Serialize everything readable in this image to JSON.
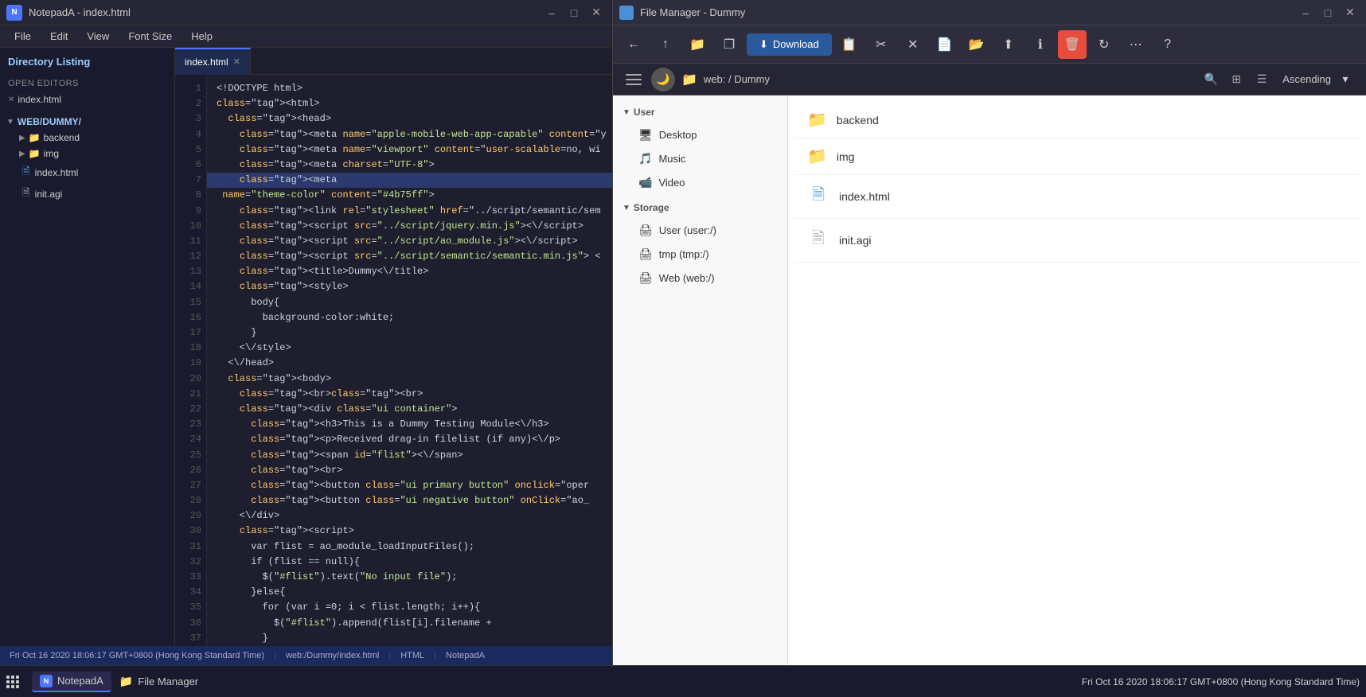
{
  "notepad": {
    "title": "NotepadA - index.html",
    "menubar": [
      "File",
      "Edit",
      "View",
      "Font Size",
      "Help"
    ],
    "tab": "index.html",
    "sidebar": {
      "directory_label": "Directory Listing",
      "open_editors_label": "OPEN EDITORS",
      "editors": [
        {
          "name": "index.html"
        }
      ],
      "folder_label": "WEB/DUMMY/",
      "folders": [
        {
          "name": "backend",
          "type": "folder"
        },
        {
          "name": "img",
          "type": "folder"
        },
        {
          "name": "index.html",
          "type": "file-html"
        },
        {
          "name": "init.agi",
          "type": "file"
        }
      ]
    },
    "lines": [
      "<!DOCTYPE html>",
      "<html>",
      "  <head>",
      "    <meta name=\"apple-mobile-web-app-capable\" content=\"y",
      "    <meta name=\"viewport\" content=\"user-scalable=no, wi",
      "    <meta charset=\"UTF-8\">",
      "    <meta name=\"theme-color\" content=\"#4b75ff\">",
      "    <link rel=\"stylesheet\" href=\"../script/semantic/sem",
      "    <script src=\"../script/jquery.min.js\"><\\/script>",
      "    <script src=\"../script/ao_module.js\"><\\/script>",
      "    <script src=\"../script/semantic/semantic.min.js\"> <",
      "    <title>Dummy<\\/title>",
      "    <style>",
      "      body{",
      "        background-color:white;",
      "      }",
      "    <\\/style>",
      "  <\\/head>",
      "  <body>",
      "    <br><br>",
      "    <div class=\"ui container\">",
      "      <h3>This is a Dummy Testing Module<\\/h3>",
      "      <p>Received drag-in filelist (if any)<\\/p>",
      "      <span id=\"flist\"><\\/span>",
      "      <br>",
      "      <button class=\"ui primary button\" onclick=\"oper",
      "      <button class=\"ui negative button\" onClick=\"ao_",
      "    <\\/div>",
      "    <script>",
      "      var flist = ao_module_loadInputFiles();",
      "      if (flist == null){",
      "        $(\"#flist\").text(\"No input file\");",
      "      }else{",
      "        for (var i =0; i < flist.length; i++){",
      "          $(\"#flist\").append(flist[i].filename +",
      "        }",
      "      }",
      "    }"
    ],
    "highlight_line": 7,
    "statusbar": {
      "datetime": "Fri Oct 16 2020 18:06:17 GMT+0800 (Hong Kong Standard Time)",
      "path": "web:/Dummy/index.html",
      "lang": "HTML",
      "app": "NotepadA"
    }
  },
  "filemanager": {
    "title": "File Manager - Dummy",
    "toolbar": {
      "download_label": "Download",
      "sort_label": "Ascending"
    },
    "addressbar": {
      "path": "web: / Dummy"
    },
    "nav": {
      "user_label": "User",
      "user_items": [
        {
          "name": "Desktop",
          "icon": "🖥"
        },
        {
          "name": "Music",
          "icon": "🎵"
        },
        {
          "name": "Video",
          "icon": "📹"
        }
      ],
      "storage_label": "Storage",
      "storage_items": [
        {
          "name": "User (user:/)",
          "icon": "🖨"
        },
        {
          "name": "tmp (tmp:/)",
          "icon": "🖨"
        },
        {
          "name": "Web (web:/)",
          "icon": "🖨"
        }
      ]
    },
    "files": [
      {
        "name": "backend",
        "type": "folder"
      },
      {
        "name": "img",
        "type": "folder"
      },
      {
        "name": "index.html",
        "type": "file-html"
      },
      {
        "name": "init.agi",
        "type": "file"
      }
    ]
  },
  "taskbar": {
    "datetime": "Fri Oct 16 2020 18:06:17 GMT+0800 (Hong Kong Standard Time)",
    "apps": [
      {
        "name": "NotepadA",
        "icon": "N"
      },
      {
        "name": "File Manager",
        "icon": "F"
      }
    ]
  }
}
